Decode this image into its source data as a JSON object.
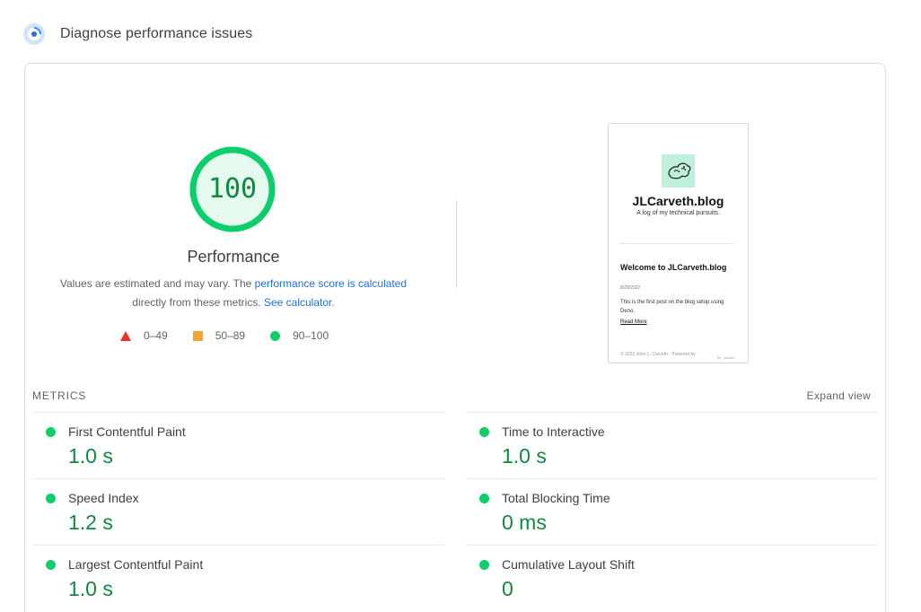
{
  "header": {
    "title": "Diagnose performance issues",
    "icon": "lighthouse-gauge-icon"
  },
  "score": {
    "value": "100",
    "fraction": 1.0,
    "label": "Performance",
    "color": "#0cce6b"
  },
  "description": {
    "part1": "Values are estimated and may vary. The ",
    "link1": "performance score is calculated",
    "part2": "directly from these metrics. ",
    "link2": "See calculator",
    "part3": "."
  },
  "legend": [
    {
      "shape": "triangle",
      "color": "#eb3223",
      "range": "0–49"
    },
    {
      "shape": "square",
      "color": "#f4a72c",
      "range": "50–89"
    },
    {
      "shape": "circle",
      "color": "#0cce6b",
      "range": "90–100"
    }
  ],
  "screenshot": {
    "site_title": "JLCarveth.blog",
    "tagline": "A log of my technical pursuits.",
    "post_title": "Welcome to JLCarveth.blog",
    "post_date": "8/29/2022",
    "post_excerpt": "This is the first post on the blog setup using Deno.",
    "read_more": "Read More",
    "footer": "© 2022 John L. Carveth · Powered by",
    "footer_right": "fly · sunum"
  },
  "metrics": {
    "title": "METRICS",
    "expand_label": "Expand view",
    "left": [
      {
        "name": "First Contentful Paint",
        "value": "1.0 s"
      },
      {
        "name": "Speed Index",
        "value": "1.2 s"
      },
      {
        "name": "Largest Contentful Paint",
        "value": "1.0 s"
      }
    ],
    "right": [
      {
        "name": "Time to Interactive",
        "value": "1.0 s"
      },
      {
        "name": "Total Blocking Time",
        "value": "0 ms"
      },
      {
        "name": "Cumulative Layout Shift",
        "value": "0"
      }
    ]
  },
  "colors": {
    "pass": "#0cce6b",
    "pass_text": "#0d8a40",
    "link": "#1a73e8"
  }
}
